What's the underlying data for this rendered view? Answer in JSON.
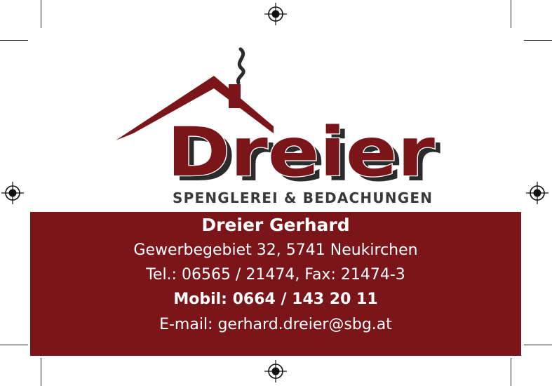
{
  "brand": {
    "name": "Dreier",
    "tagline": "SPENGLEREI & BEDACHUNGEN",
    "color": "#7a1519",
    "shadow_color": "#2b2b2b"
  },
  "contact": {
    "name": "Dreier Gerhard",
    "address": "Gewerbegebiet 32, 5741 Neukirchen",
    "phone": "Tel.: 06565 / 21474, Fax: 21474-3",
    "mobile": "Mobil: 0664 / 143 20 11",
    "email": "E-mail: gerhard.dreier@sbg.at"
  },
  "icons": {
    "logo": "house-roof-chimney-icon",
    "registration_mark": "registration-mark-icon"
  }
}
